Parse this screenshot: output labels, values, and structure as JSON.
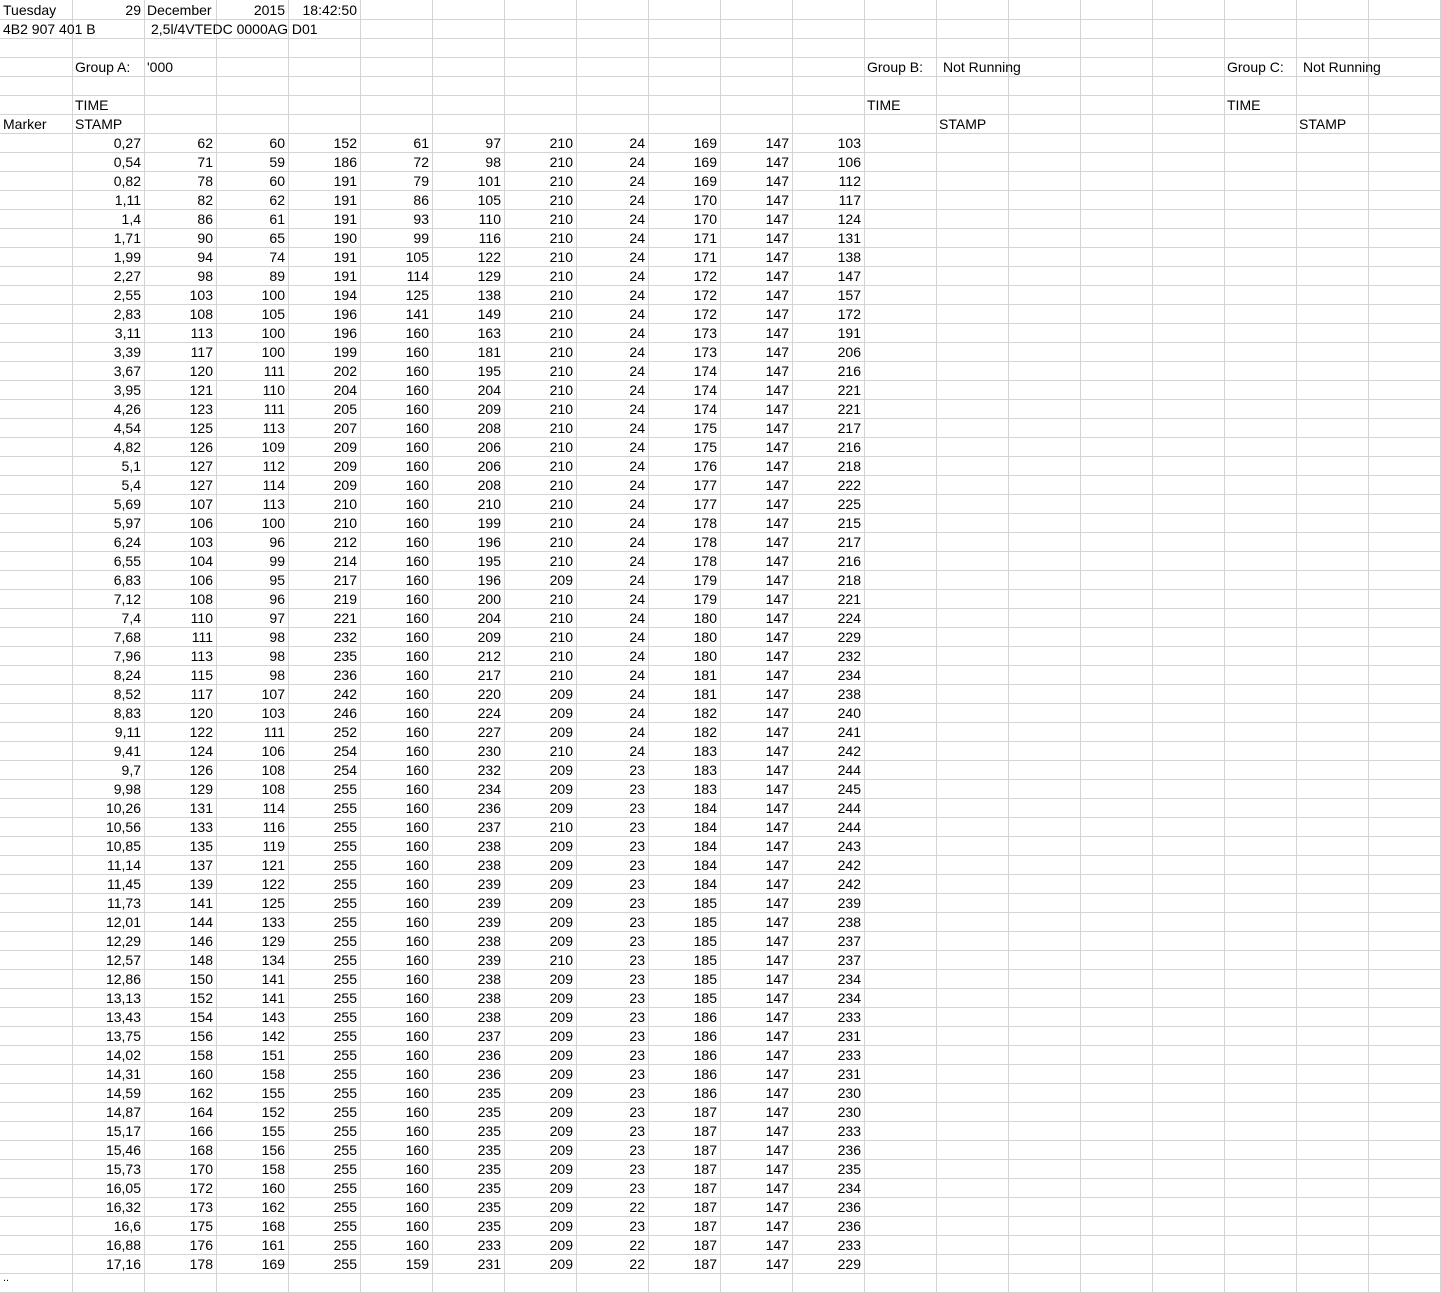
{
  "header": {
    "weekday": "Tuesday",
    "day": "29",
    "month": "December",
    "year": "2015",
    "time": "18:42:50",
    "part_number": "4B2 907 401 B",
    "ecu_description": "2,5l/4VTEDC 0000AG D01"
  },
  "groups": {
    "a": {
      "label": "Group A:",
      "value": "'000"
    },
    "b": {
      "label": "Group B:",
      "value": "Not Running"
    },
    "c": {
      "label": "Group C:",
      "value": "Not Running"
    }
  },
  "labels": {
    "time": "TIME",
    "stamp": "STAMP",
    "marker": "Marker"
  },
  "footer_mark": "..",
  "rows": [
    [
      "0,27",
      "62",
      "60",
      "152",
      "61",
      "97",
      "210",
      "24",
      "169",
      "147",
      "103"
    ],
    [
      "0,54",
      "71",
      "59",
      "186",
      "72",
      "98",
      "210",
      "24",
      "169",
      "147",
      "106"
    ],
    [
      "0,82",
      "78",
      "60",
      "191",
      "79",
      "101",
      "210",
      "24",
      "169",
      "147",
      "112"
    ],
    [
      "1,11",
      "82",
      "62",
      "191",
      "86",
      "105",
      "210",
      "24",
      "170",
      "147",
      "117"
    ],
    [
      "1,4",
      "86",
      "61",
      "191",
      "93",
      "110",
      "210",
      "24",
      "170",
      "147",
      "124"
    ],
    [
      "1,71",
      "90",
      "65",
      "190",
      "99",
      "116",
      "210",
      "24",
      "171",
      "147",
      "131"
    ],
    [
      "1,99",
      "94",
      "74",
      "191",
      "105",
      "122",
      "210",
      "24",
      "171",
      "147",
      "138"
    ],
    [
      "2,27",
      "98",
      "89",
      "191",
      "114",
      "129",
      "210",
      "24",
      "172",
      "147",
      "147"
    ],
    [
      "2,55",
      "103",
      "100",
      "194",
      "125",
      "138",
      "210",
      "24",
      "172",
      "147",
      "157"
    ],
    [
      "2,83",
      "108",
      "105",
      "196",
      "141",
      "149",
      "210",
      "24",
      "172",
      "147",
      "172"
    ],
    [
      "3,11",
      "113",
      "100",
      "196",
      "160",
      "163",
      "210",
      "24",
      "173",
      "147",
      "191"
    ],
    [
      "3,39",
      "117",
      "100",
      "199",
      "160",
      "181",
      "210",
      "24",
      "173",
      "147",
      "206"
    ],
    [
      "3,67",
      "120",
      "111",
      "202",
      "160",
      "195",
      "210",
      "24",
      "174",
      "147",
      "216"
    ],
    [
      "3,95",
      "121",
      "110",
      "204",
      "160",
      "204",
      "210",
      "24",
      "174",
      "147",
      "221"
    ],
    [
      "4,26",
      "123",
      "111",
      "205",
      "160",
      "209",
      "210",
      "24",
      "174",
      "147",
      "221"
    ],
    [
      "4,54",
      "125",
      "113",
      "207",
      "160",
      "208",
      "210",
      "24",
      "175",
      "147",
      "217"
    ],
    [
      "4,82",
      "126",
      "109",
      "209",
      "160",
      "206",
      "210",
      "24",
      "175",
      "147",
      "216"
    ],
    [
      "5,1",
      "127",
      "112",
      "209",
      "160",
      "206",
      "210",
      "24",
      "176",
      "147",
      "218"
    ],
    [
      "5,4",
      "127",
      "114",
      "209",
      "160",
      "208",
      "210",
      "24",
      "177",
      "147",
      "222"
    ],
    [
      "5,69",
      "107",
      "113",
      "210",
      "160",
      "210",
      "210",
      "24",
      "177",
      "147",
      "225"
    ],
    [
      "5,97",
      "106",
      "100",
      "210",
      "160",
      "199",
      "210",
      "24",
      "178",
      "147",
      "215"
    ],
    [
      "6,24",
      "103",
      "96",
      "212",
      "160",
      "196",
      "210",
      "24",
      "178",
      "147",
      "217"
    ],
    [
      "6,55",
      "104",
      "99",
      "214",
      "160",
      "195",
      "210",
      "24",
      "178",
      "147",
      "216"
    ],
    [
      "6,83",
      "106",
      "95",
      "217",
      "160",
      "196",
      "209",
      "24",
      "179",
      "147",
      "218"
    ],
    [
      "7,12",
      "108",
      "96",
      "219",
      "160",
      "200",
      "210",
      "24",
      "179",
      "147",
      "221"
    ],
    [
      "7,4",
      "110",
      "97",
      "221",
      "160",
      "204",
      "210",
      "24",
      "180",
      "147",
      "224"
    ],
    [
      "7,68",
      "111",
      "98",
      "232",
      "160",
      "209",
      "210",
      "24",
      "180",
      "147",
      "229"
    ],
    [
      "7,96",
      "113",
      "98",
      "235",
      "160",
      "212",
      "210",
      "24",
      "180",
      "147",
      "232"
    ],
    [
      "8,24",
      "115",
      "98",
      "236",
      "160",
      "217",
      "210",
      "24",
      "181",
      "147",
      "234"
    ],
    [
      "8,52",
      "117",
      "107",
      "242",
      "160",
      "220",
      "209",
      "24",
      "181",
      "147",
      "238"
    ],
    [
      "8,83",
      "120",
      "103",
      "246",
      "160",
      "224",
      "209",
      "24",
      "182",
      "147",
      "240"
    ],
    [
      "9,11",
      "122",
      "111",
      "252",
      "160",
      "227",
      "209",
      "24",
      "182",
      "147",
      "241"
    ],
    [
      "9,41",
      "124",
      "106",
      "254",
      "160",
      "230",
      "210",
      "24",
      "183",
      "147",
      "242"
    ],
    [
      "9,7",
      "126",
      "108",
      "254",
      "160",
      "232",
      "209",
      "23",
      "183",
      "147",
      "244"
    ],
    [
      "9,98",
      "129",
      "108",
      "255",
      "160",
      "234",
      "209",
      "23",
      "183",
      "147",
      "245"
    ],
    [
      "10,26",
      "131",
      "114",
      "255",
      "160",
      "236",
      "209",
      "23",
      "184",
      "147",
      "244"
    ],
    [
      "10,56",
      "133",
      "116",
      "255",
      "160",
      "237",
      "210",
      "23",
      "184",
      "147",
      "244"
    ],
    [
      "10,85",
      "135",
      "119",
      "255",
      "160",
      "238",
      "209",
      "23",
      "184",
      "147",
      "243"
    ],
    [
      "11,14",
      "137",
      "121",
      "255",
      "160",
      "238",
      "209",
      "23",
      "184",
      "147",
      "242"
    ],
    [
      "11,45",
      "139",
      "122",
      "255",
      "160",
      "239",
      "209",
      "23",
      "184",
      "147",
      "242"
    ],
    [
      "11,73",
      "141",
      "125",
      "255",
      "160",
      "239",
      "209",
      "23",
      "185",
      "147",
      "239"
    ],
    [
      "12,01",
      "144",
      "133",
      "255",
      "160",
      "239",
      "209",
      "23",
      "185",
      "147",
      "238"
    ],
    [
      "12,29",
      "146",
      "129",
      "255",
      "160",
      "238",
      "209",
      "23",
      "185",
      "147",
      "237"
    ],
    [
      "12,57",
      "148",
      "134",
      "255",
      "160",
      "239",
      "210",
      "23",
      "185",
      "147",
      "237"
    ],
    [
      "12,86",
      "150",
      "141",
      "255",
      "160",
      "238",
      "209",
      "23",
      "185",
      "147",
      "234"
    ],
    [
      "13,13",
      "152",
      "141",
      "255",
      "160",
      "238",
      "209",
      "23",
      "185",
      "147",
      "234"
    ],
    [
      "13,43",
      "154",
      "143",
      "255",
      "160",
      "238",
      "209",
      "23",
      "186",
      "147",
      "233"
    ],
    [
      "13,75",
      "156",
      "142",
      "255",
      "160",
      "237",
      "209",
      "23",
      "186",
      "147",
      "231"
    ],
    [
      "14,02",
      "158",
      "151",
      "255",
      "160",
      "236",
      "209",
      "23",
      "186",
      "147",
      "233"
    ],
    [
      "14,31",
      "160",
      "158",
      "255",
      "160",
      "236",
      "209",
      "23",
      "186",
      "147",
      "231"
    ],
    [
      "14,59",
      "162",
      "155",
      "255",
      "160",
      "235",
      "209",
      "23",
      "186",
      "147",
      "230"
    ],
    [
      "14,87",
      "164",
      "152",
      "255",
      "160",
      "235",
      "209",
      "23",
      "187",
      "147",
      "230"
    ],
    [
      "15,17",
      "166",
      "155",
      "255",
      "160",
      "235",
      "209",
      "23",
      "187",
      "147",
      "233"
    ],
    [
      "15,46",
      "168",
      "156",
      "255",
      "160",
      "235",
      "209",
      "23",
      "187",
      "147",
      "236"
    ],
    [
      "15,73",
      "170",
      "158",
      "255",
      "160",
      "235",
      "209",
      "23",
      "187",
      "147",
      "235"
    ],
    [
      "16,05",
      "172",
      "160",
      "255",
      "160",
      "235",
      "209",
      "23",
      "187",
      "147",
      "234"
    ],
    [
      "16,32",
      "173",
      "162",
      "255",
      "160",
      "235",
      "209",
      "22",
      "187",
      "147",
      "236"
    ],
    [
      "16,6",
      "175",
      "168",
      "255",
      "160",
      "235",
      "209",
      "23",
      "187",
      "147",
      "236"
    ],
    [
      "16,88",
      "176",
      "161",
      "255",
      "160",
      "233",
      "209",
      "22",
      "187",
      "147",
      "233"
    ],
    [
      "17,16",
      "178",
      "169",
      "255",
      "159",
      "231",
      "209",
      "22",
      "187",
      "147",
      "229"
    ]
  ]
}
